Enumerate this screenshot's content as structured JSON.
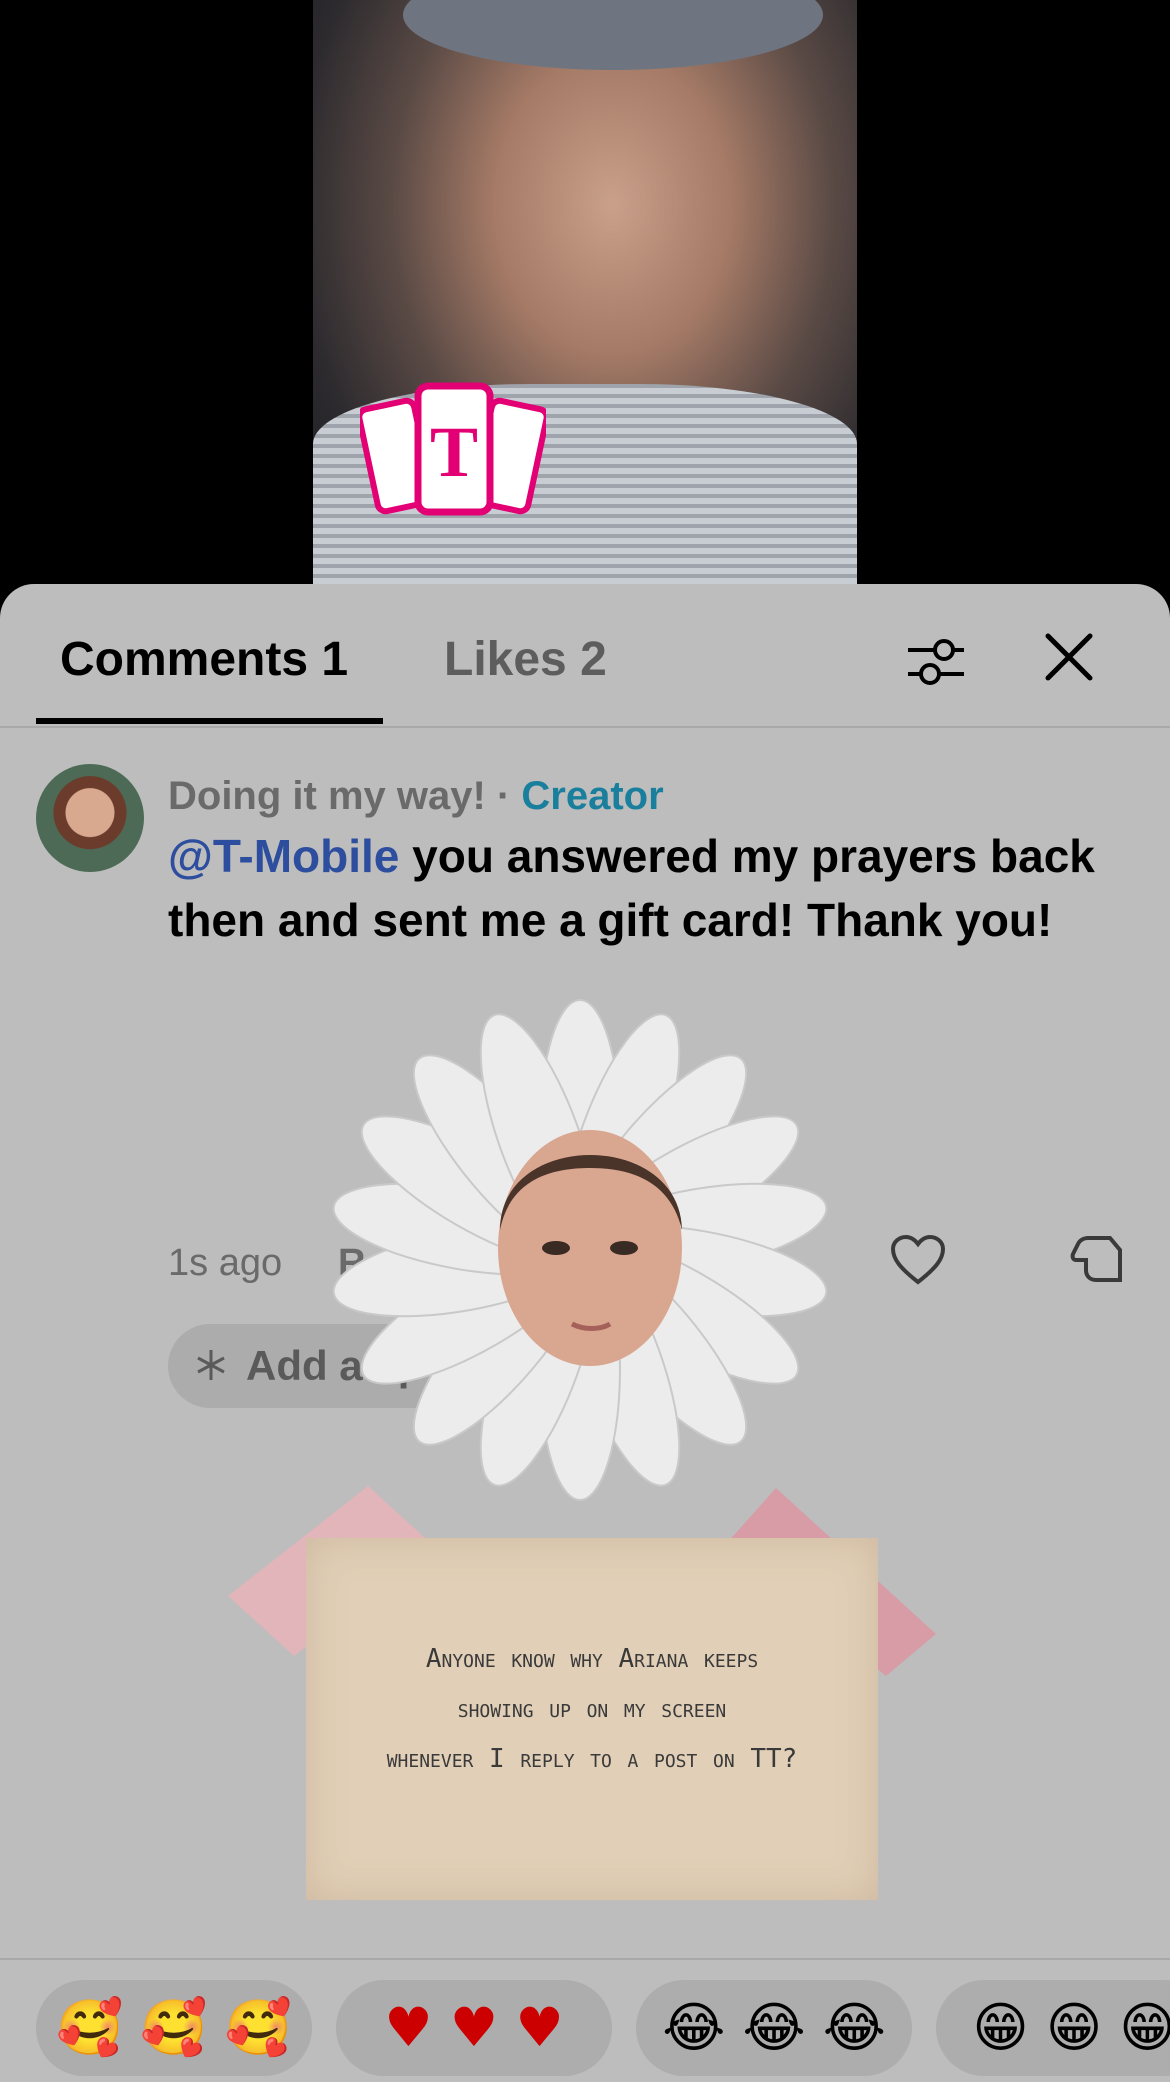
{
  "sticker": {
    "brand_letter": "T"
  },
  "tabs": [
    {
      "label": "Comments 1"
    },
    {
      "label": "Likes 2"
    }
  ],
  "comment": {
    "author": "Doing it my way!",
    "separator": "·",
    "badge": "Creator",
    "mention": "@T-Mobile",
    "text": " you answered my prayers back then and sent me a gift card! Thank you!",
    "time": "1s ago",
    "reply_label": "Rep",
    "add_chip_label": "Add as p"
  },
  "note": {
    "line1": "Anyone know why Ariana keeps",
    "line2": "showing up on my screen",
    "line3": "whenever I reply to a post on TT?"
  },
  "emoji_chips": [
    "🥰 🥰 🥰",
    "♥ ♥ ♥",
    "😂 😂 😂",
    "😁 😁 😁"
  ],
  "colors": {
    "creator": "#1a7f9c",
    "mention": "#2d4d9e",
    "tmobile": "#e20074"
  },
  "icons": {
    "filter": "filter-sliders-icon",
    "close": "close-icon",
    "heart": "heart-icon",
    "dislike": "thumbs-down-icon",
    "sparkle": "sparkle-icon"
  }
}
